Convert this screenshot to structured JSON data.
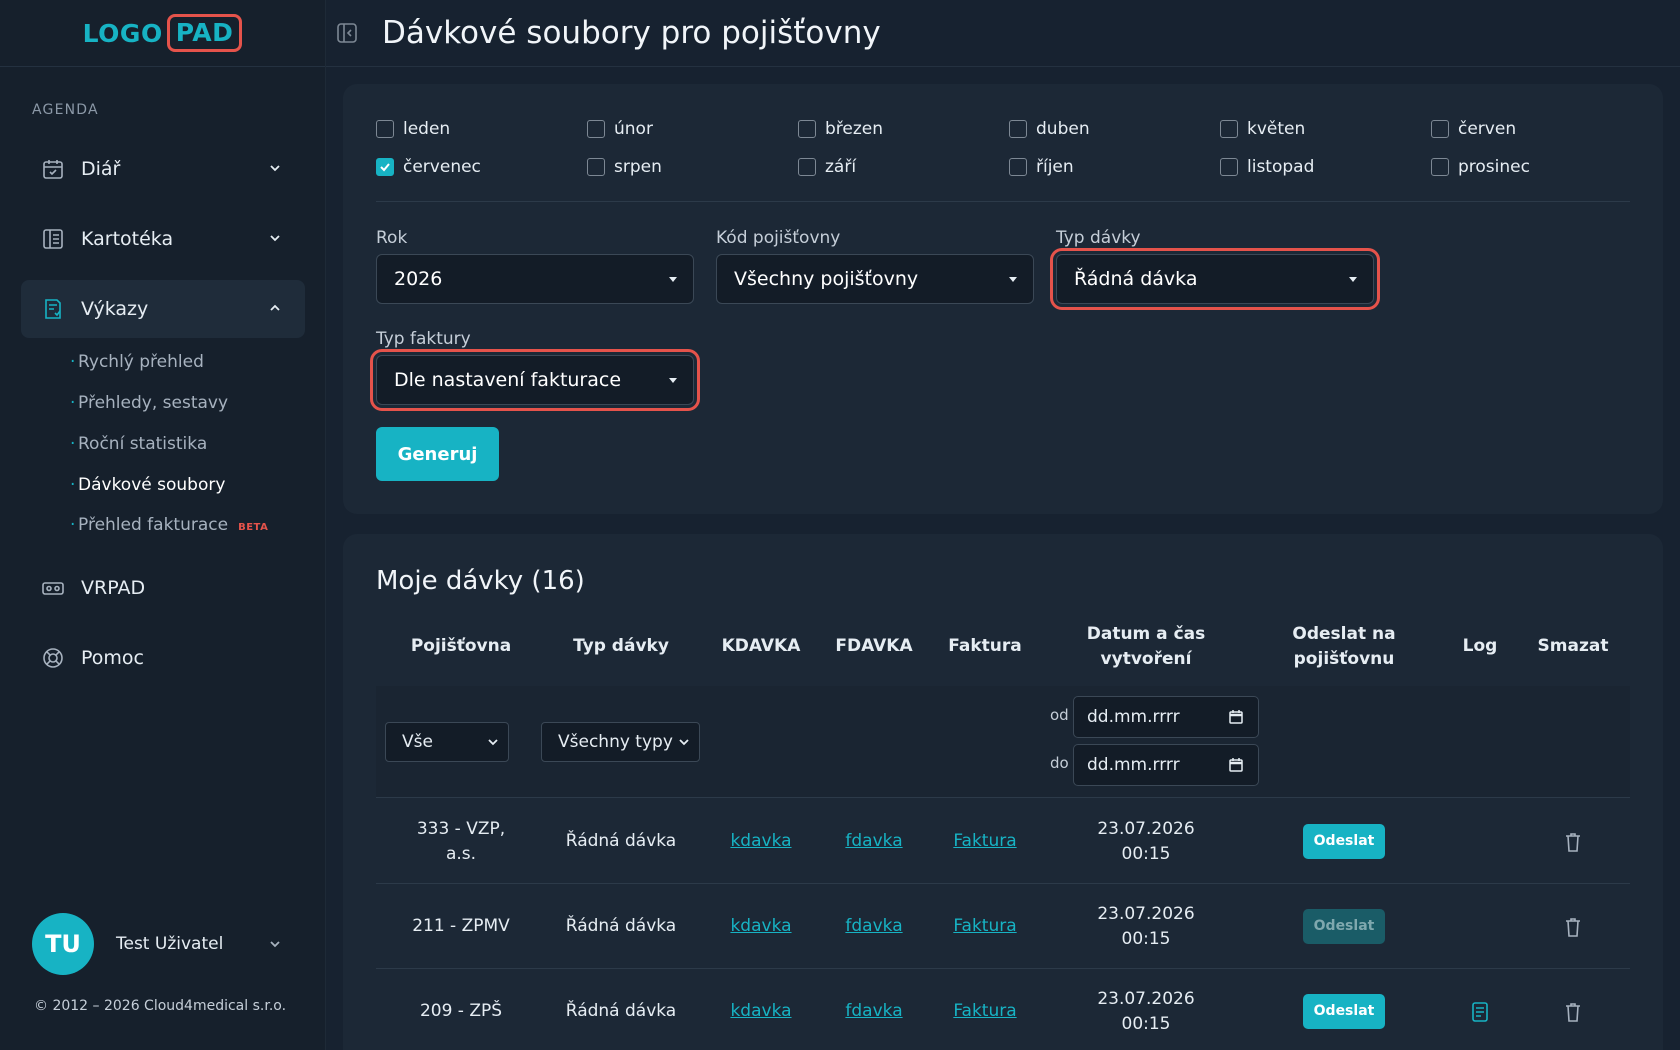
{
  "logo": {
    "part1": "LOGO",
    "part2": "PAD"
  },
  "sidebar": {
    "section_label": "AGENDA",
    "items": [
      {
        "label": "Diář"
      },
      {
        "label": "Kartotéka"
      },
      {
        "label": "Výkazy"
      },
      {
        "label": "VRPAD"
      },
      {
        "label": "Pomoc"
      }
    ],
    "sub_items": [
      {
        "label": "Rychlý přehled"
      },
      {
        "label": "Přehledy, sestavy"
      },
      {
        "label": "Roční statistika"
      },
      {
        "label": "Dávkové soubory"
      },
      {
        "label": "Přehled fakturace"
      }
    ],
    "beta_badge": "BETA"
  },
  "user": {
    "initials": "TU",
    "name": "Test Uživatel"
  },
  "copyright": "© 2012 – 2026 Cloud4medical s.r.o.",
  "header": {
    "title": "Dávkové soubory pro pojišťovny"
  },
  "filters": {
    "months": [
      {
        "label": "leden",
        "checked": false
      },
      {
        "label": "únor",
        "checked": false
      },
      {
        "label": "březen",
        "checked": false
      },
      {
        "label": "duben",
        "checked": false
      },
      {
        "label": "květen",
        "checked": false
      },
      {
        "label": "červen",
        "checked": false
      },
      {
        "label": "červenec",
        "checked": true
      },
      {
        "label": "srpen",
        "checked": false
      },
      {
        "label": "září",
        "checked": false
      },
      {
        "label": "říjen",
        "checked": false
      },
      {
        "label": "listopad",
        "checked": false
      },
      {
        "label": "prosinec",
        "checked": false
      }
    ],
    "year_label": "Rok",
    "year_value": "2026",
    "insurer_label": "Kód pojišťovny",
    "insurer_value": "Všechny pojišťovny",
    "batch_type_label": "Typ dávky",
    "batch_type_value": "Řádná dávka",
    "invoice_type_label": "Typ faktury",
    "invoice_type_value": "Dle nastavení fakturace",
    "generate_label": "Generuj"
  },
  "list": {
    "title": "Moje dávky (16)",
    "columns": {
      "insurer": "Pojišťovna",
      "type": "Typ dávky",
      "kdavka": "KDAVKA",
      "fdavka": "FDAVKA",
      "invoice": "Faktura",
      "created_1": "Datum a čas",
      "created_2": "vytvoření",
      "send_1": "Odeslat na",
      "send_2": "pojišťovnu",
      "log": "Log",
      "delete": "Smazat"
    },
    "filter_insurer": "Vše",
    "filter_type": "Všechny typy",
    "date_from_label": "od",
    "date_to_label": "do",
    "date_placeholder": "dd.mm.rrrr",
    "rows": [
      {
        "insurer_1": "333 - VZP,",
        "insurer_2": "a.s.",
        "type": "Řádná dávka",
        "kdavka": "kdavka",
        "fdavka": "fdavka",
        "invoice": "Faktura",
        "date": "23.07.2026",
        "time": "00:15",
        "send": "Odeslat",
        "send_enabled": true,
        "has_log": false
      },
      {
        "insurer_1": "211 - ZPMV",
        "insurer_2": "",
        "type": "Řádná dávka",
        "kdavka": "kdavka",
        "fdavka": "fdavka",
        "invoice": "Faktura",
        "date": "23.07.2026",
        "time": "00:15",
        "send": "Odeslat",
        "send_enabled": false,
        "has_log": false
      },
      {
        "insurer_1": "209 - ZPŠ",
        "insurer_2": "",
        "type": "Řádná dávka",
        "kdavka": "kdavka",
        "fdavka": "fdavka",
        "invoice": "Faktura",
        "date": "23.07.2026",
        "time": "00:15",
        "send": "Odeslat",
        "send_enabled": true,
        "has_log": true
      }
    ]
  },
  "colors": {
    "accent": "#17b3c4",
    "highlight": "#e5534b",
    "background": "#172230"
  }
}
